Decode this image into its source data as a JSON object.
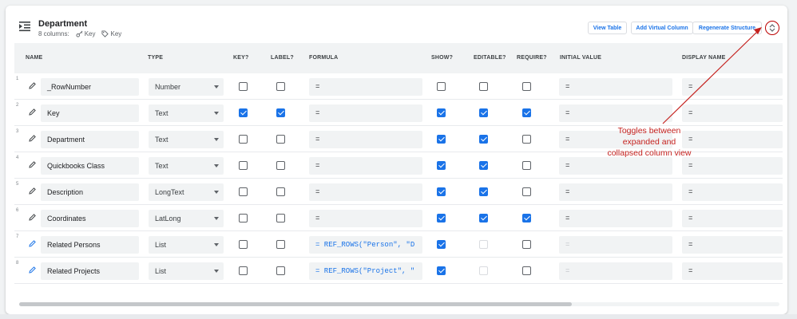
{
  "header": {
    "title": "Department",
    "column_count": "8 columns:",
    "key_label": "Key",
    "label_label": "Key"
  },
  "toolbar": {
    "view_table": "View Table",
    "add_virtual_column": "Add Virtual Column",
    "regenerate_structure": "Regenerate Structure"
  },
  "columns_header": {
    "name": "NAME",
    "type": "TYPE",
    "key": "KEY?",
    "label": "LABEL?",
    "formula": "FORMULA",
    "show": "SHOW?",
    "editable": "EDITABLE?",
    "require": "REQUIRE?",
    "initial_value": "INITIAL VALUE",
    "display_name": "DISPLAY NAME"
  },
  "rows": [
    {
      "num": "1",
      "name": "_RowNumber",
      "type": "Number",
      "key": false,
      "label": false,
      "formula": "=",
      "show": false,
      "editable": false,
      "require": false,
      "initial": "=",
      "display": "="
    },
    {
      "num": "2",
      "name": "Key",
      "type": "Text",
      "key": true,
      "label": true,
      "formula": "=",
      "show": true,
      "editable": true,
      "require": true,
      "initial": "=",
      "display": "="
    },
    {
      "num": "3",
      "name": "Department",
      "type": "Text",
      "key": false,
      "label": false,
      "formula": "=",
      "show": true,
      "editable": true,
      "require": false,
      "initial": "=",
      "display": "="
    },
    {
      "num": "4",
      "name": "Quickbooks Class",
      "type": "Text",
      "key": false,
      "label": false,
      "formula": "=",
      "show": true,
      "editable": true,
      "require": false,
      "initial": "=",
      "display": "="
    },
    {
      "num": "5",
      "name": "Description",
      "type": "LongText",
      "key": false,
      "label": false,
      "formula": "=",
      "show": true,
      "editable": true,
      "require": false,
      "initial": "=",
      "display": "="
    },
    {
      "num": "6",
      "name": "Coordinates",
      "type": "LatLong",
      "key": false,
      "label": false,
      "formula": "=",
      "show": true,
      "editable": true,
      "require": true,
      "initial": "=",
      "display": "="
    },
    {
      "num": "7",
      "name": "Related Persons",
      "type": "List",
      "key": false,
      "label": false,
      "formula": "= REF_ROWS(\"Person\", \"D",
      "show": true,
      "editable": false,
      "require": false,
      "initial": "=",
      "display": "=",
      "virtual": true
    },
    {
      "num": "8",
      "name": "Related Projects",
      "type": "List",
      "key": false,
      "label": false,
      "formula": "= REF_ROWS(\"Project\", \"",
      "show": true,
      "editable": false,
      "require": false,
      "initial": "=",
      "display": "=",
      "virtual": true
    }
  ],
  "annotation": {
    "line1": "Toggles between",
    "line2": "expanded and",
    "line3": "collapsed column view"
  },
  "colors": {
    "accent": "#1a73e8",
    "annotation": "#c5221f"
  },
  "icons": [
    "table-collapse-icon",
    "key-icon",
    "tag-icon",
    "pencil-icon",
    "expand-collapse-icon"
  ]
}
